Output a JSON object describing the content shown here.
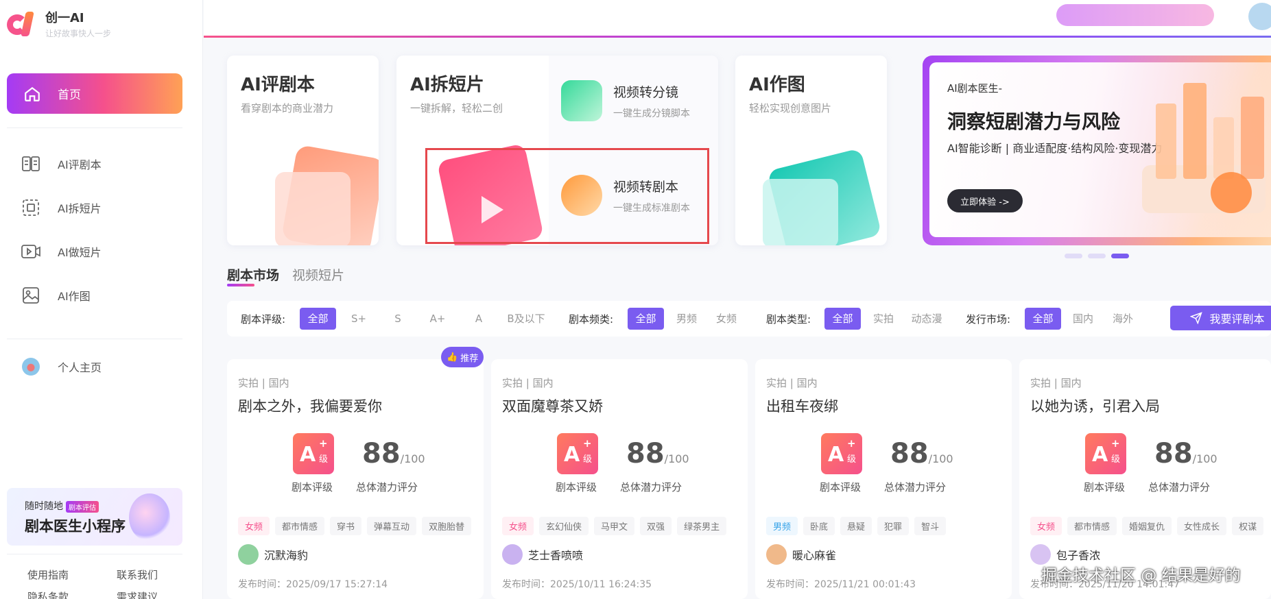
{
  "app": {
    "name": "创一AI",
    "slogan": "让好故事快人一步"
  },
  "sidebar": {
    "home": "首页",
    "items": [
      {
        "label": "AI评剧本",
        "icon": "script-review-icon"
      },
      {
        "label": "AI拆短片",
        "icon": "split-clip-icon"
      },
      {
        "label": "AI做短片",
        "icon": "make-video-icon"
      },
      {
        "label": "AI作图",
        "icon": "image-icon"
      }
    ],
    "profile": "个人主页",
    "banner": {
      "line1": "随时随地",
      "tag": "剧本评估",
      "line2": "剧本医生小程序"
    },
    "footer": {
      "guide": "使用指南",
      "contact": "联系我们",
      "privacy": "隐私条款",
      "feedback": "需求建议"
    }
  },
  "features": {
    "review": {
      "title": "AI评剧本",
      "sub": "看穿剧本的商业潜力"
    },
    "split": {
      "title": "AI拆短片",
      "sub": "一键拆解，轻松二创"
    },
    "storyboard": {
      "title": "视频转分镜",
      "sub": "一键生成分镜脚本"
    },
    "toscript": {
      "title": "视频转剧本",
      "sub": "一键生成标准剧本"
    },
    "image": {
      "title": "AI作图",
      "sub": "轻松实现创意图片"
    }
  },
  "promo": {
    "kicker": "AI剧本医生-",
    "headline": "洞察短剧潜力与风险",
    "desc": "AI智能诊断 | 商业适配度·结构风险·变现潜力",
    "button": "立即体验 ->"
  },
  "tabs": [
    "剧本市场",
    "视频短片"
  ],
  "filters": {
    "grade": {
      "label": "剧本评级:",
      "options": [
        "全部",
        "S+",
        "S",
        "A+",
        "A",
        "B及以下"
      ]
    },
    "channel": {
      "label": "剧本频类:",
      "options": [
        "全部",
        "男频",
        "女频"
      ]
    },
    "type": {
      "label": "剧本类型:",
      "options": [
        "全部",
        "实拍",
        "动态漫"
      ]
    },
    "market": {
      "label": "发行市场:",
      "options": [
        "全部",
        "国内",
        "海外"
      ]
    }
  },
  "review_button": "我要评剧本",
  "recommend_badge": "推荐",
  "cards": [
    {
      "cat": "实拍 | 国内",
      "title": "剧本之外，我偏要爱你",
      "grade": "A",
      "plus": "+",
      "grade_unit": "级",
      "grade_label": "剧本评级",
      "score": "88",
      "score_den": "/100",
      "score_label": "总体潜力评分",
      "tags": [
        "女频",
        "都市情感",
        "穿书",
        "弹幕互动",
        "双胞胎替"
      ],
      "author": "沉默海豹",
      "date": "发布时间：2025/09/17 15:27:14"
    },
    {
      "cat": "实拍 | 国内",
      "title": "双面魔尊茶又娇",
      "grade": "A",
      "plus": "+",
      "grade_unit": "级",
      "grade_label": "剧本评级",
      "score": "88",
      "score_den": "/100",
      "score_label": "总体潜力评分",
      "tags": [
        "女频",
        "玄幻仙侠",
        "马甲文",
        "双强",
        "绿茶男主"
      ],
      "author": "芝士香喷喷",
      "date": "发布时间：2025/10/11 16:24:35"
    },
    {
      "cat": "实拍 | 国内",
      "title": "出租车夜绑",
      "grade": "A",
      "plus": "+",
      "grade_unit": "级",
      "grade_label": "剧本评级",
      "score": "88",
      "score_den": "/100",
      "score_label": "总体潜力评分",
      "tags": [
        "男频",
        "卧底",
        "悬疑",
        "犯罪",
        "智斗"
      ],
      "author": "暖心麻雀",
      "date": "发布时间：2025/11/21 00:01:43"
    },
    {
      "cat": "实拍 | 国内",
      "title": "以她为诱，引君入局",
      "grade": "A",
      "plus": "+",
      "grade_unit": "级",
      "grade_label": "剧本评级",
      "score": "88",
      "score_den": "/100",
      "score_label": "总体潜力评分",
      "tags": [
        "女频",
        "都市情感",
        "婚姻复仇",
        "女性成长",
        "权谋"
      ],
      "author": "包子香浓",
      "date": "发布时间：2025/11/20 14:01:47"
    }
  ],
  "watermark": "掘金技术社区 @ 结果是好的"
}
